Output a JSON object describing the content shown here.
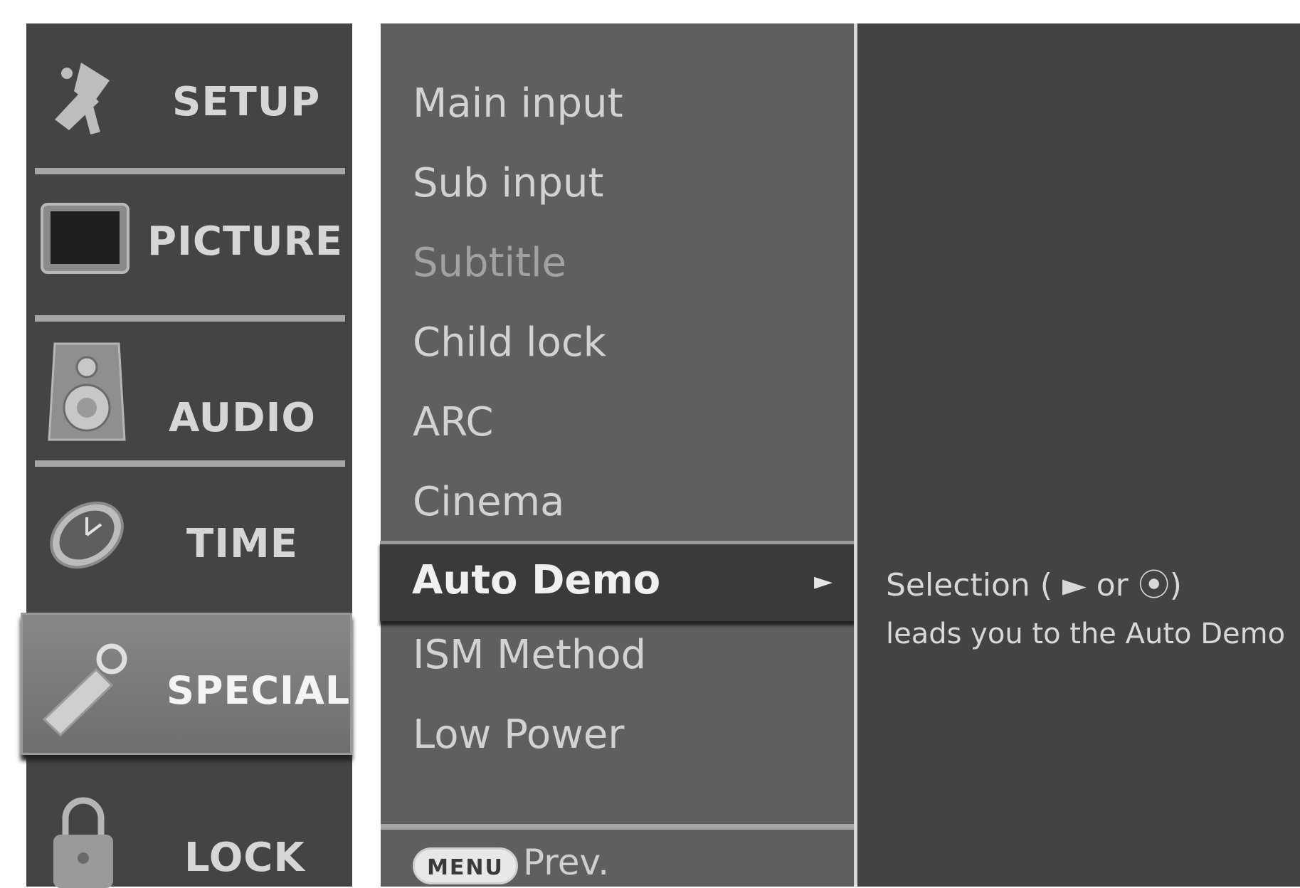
{
  "categories": [
    {
      "id": "setup",
      "label": "SETUP",
      "icon": "satellite-icon"
    },
    {
      "id": "picture",
      "label": "PICTURE",
      "icon": "tv-screen-icon"
    },
    {
      "id": "audio",
      "label": "AUDIO",
      "icon": "speaker-icon"
    },
    {
      "id": "time",
      "label": "TIME",
      "icon": "clock-icon"
    },
    {
      "id": "special",
      "label": "SPECIAL",
      "icon": "tag-icon",
      "selected": true
    },
    {
      "id": "lock",
      "label": "LOCK",
      "icon": "padlock-icon"
    }
  ],
  "options": {
    "items": [
      {
        "label": "Main input",
        "enabled": true
      },
      {
        "label": "Sub input",
        "enabled": true
      },
      {
        "label": "Subtitle",
        "enabled": false
      },
      {
        "label": "Child lock",
        "enabled": true
      },
      {
        "label": "ARC",
        "enabled": true
      },
      {
        "label": "Cinema",
        "enabled": true
      },
      {
        "label": "Auto Demo",
        "enabled": true,
        "selected": true
      },
      {
        "label": "ISM Method",
        "enabled": true
      },
      {
        "label": "Low Power",
        "enabled": true
      }
    ],
    "selected_arrow": "►"
  },
  "footer": {
    "menu_button": "MENU",
    "prev_label": "Prev."
  },
  "description": {
    "line1": "Selection ( ► or ⦿)",
    "line2": "leads you to the Auto Demo"
  }
}
